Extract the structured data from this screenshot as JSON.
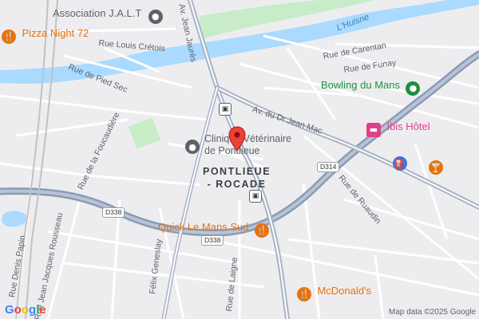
{
  "map": {
    "neighborhood": "PONTLIEUE\n- ROCADE",
    "neighborhood_line1": "PONTLIEUE",
    "neighborhood_line2": "- ROCADE",
    "river": "L'Huisne",
    "roads": {
      "louis_cretois": "Rue Louis Crétois",
      "jean_jaures": "Av. Jean Jaurès",
      "pied_sec": "Rue de Pied Sec",
      "carentan": "Rue de Carentan",
      "funay": "Rue de Funay",
      "jean_mac": "Av. du Dr Jean Mac",
      "foucaudiere": "Rue de la Foucaudière",
      "ruaudin": "Rue de Ruaudin",
      "jj_rousseau": "Rue Jean Jacques Rousseau",
      "denis_papin": "Rue Denis Papin",
      "felix_geneslay": "Félix Geneslay",
      "laigne": "Rue de Laigne"
    },
    "shields": {
      "d314": "D314",
      "d338_west": "D338",
      "d338_center": "D338"
    },
    "pois": {
      "association": "Association J.A.L.T",
      "pizza": "Pizza Night 72",
      "bowling": "Bowling du Mans",
      "ibis": "Ibis Hôtel",
      "clinique_line1": "Clinique Vétérinaire",
      "clinique_line2": "de Pontlieue",
      "quick": "Quick Le Mans Sud",
      "mcdonalds": "McDonald's"
    },
    "colors": {
      "restaurant": "#e8710a",
      "hotel": "#e0408a",
      "leisure": "#1e8e3e",
      "generic": "#5f6368",
      "marker": "#ea4335",
      "road_major": "#8a9bb5",
      "water": "#aadaff",
      "park": "#c8ecc8"
    },
    "icons": {
      "restaurant": "fork-knife-icon",
      "hotel": "bed-icon",
      "leisure": "bowling-icon",
      "generic": "place-icon",
      "fuel": "fuel-icon",
      "bar": "cocktail-icon",
      "transit": "bus-icon"
    },
    "branding": {
      "logo": "Google",
      "attribution": "Map data ©2025 Google"
    }
  }
}
